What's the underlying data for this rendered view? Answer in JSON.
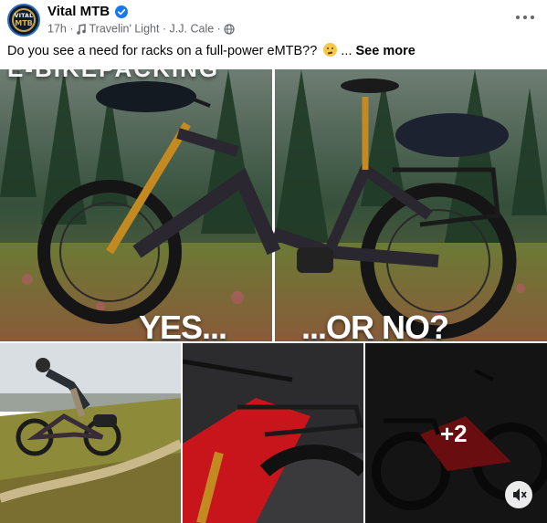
{
  "post": {
    "page_name": "Vital MTB",
    "avatar_top": "VITAL",
    "avatar_bottom": "MTB",
    "time": "17h",
    "separator": "·",
    "music": "Travelin' Light · J.J. Cale",
    "audience_icon": "globe-icon",
    "caption": "Do you see a need for racks on a full-power eMTB??",
    "ellipsis": "...",
    "see_more": "See more"
  },
  "gallery": {
    "banner_text": "E-BIKEPACKING",
    "left_overlay": "YES...",
    "right_overlay": "...OR NO?",
    "more_count": "+2",
    "mute_icon": "muted-speaker-icon"
  },
  "colors": {
    "verified_blue": "#1877f2",
    "meta_gray": "#65676b"
  }
}
